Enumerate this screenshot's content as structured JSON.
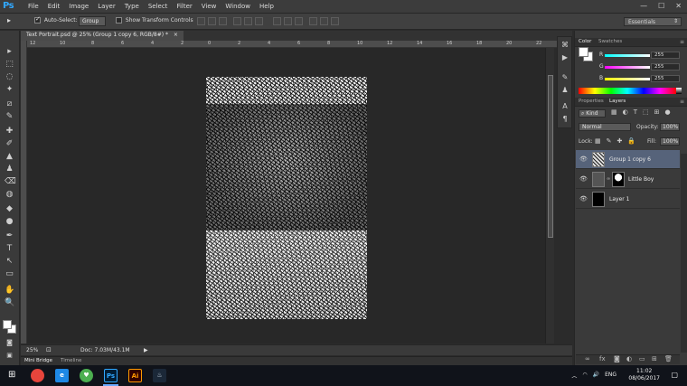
{
  "app": {
    "logo": "Ps",
    "menu": [
      "File",
      "Edit",
      "Image",
      "Layer",
      "Type",
      "Select",
      "Filter",
      "View",
      "Window",
      "Help"
    ],
    "window_controls": [
      "—",
      "☐",
      "✕"
    ]
  },
  "options_bar": {
    "tool_glyph": "▸",
    "auto_select_label": "Auto-Select:",
    "auto_select_checked": true,
    "auto_select_target": "Group",
    "transform_controls_label": "Show Transform Controls",
    "transform_controls_checked": false,
    "workspace": "Essentials"
  },
  "document": {
    "tab_title": "Text Portrait.psd @ 25% (Group 1 copy 6, RGB/8#) *",
    "ruler_top": [
      "12",
      "10",
      "8",
      "6",
      "4",
      "2",
      "0",
      "2",
      "4",
      "6",
      "8",
      "10",
      "12",
      "14",
      "16",
      "18",
      "20",
      "22"
    ],
    "zoom": "25%",
    "doc_info": "Doc: 7.03M/43.1M",
    "status_arrow": "▶"
  },
  "bottom_tabs": [
    "Mini Bridge",
    "Timeline"
  ],
  "tools": [
    "▸",
    "⬚",
    "◌",
    "✦",
    "⧄",
    "✎",
    "✚",
    "✐",
    "▲",
    "♟",
    "⌫",
    "◍",
    "◆",
    "●",
    "✒",
    "T",
    "↖",
    "▭",
    "✋",
    "🔍"
  ],
  "color_panel": {
    "tabs": [
      "Color",
      "Swatches"
    ],
    "channels": [
      {
        "label": "R",
        "value": "255",
        "color": "#ff2a2a"
      },
      {
        "label": "G",
        "value": "255",
        "color": "#2aff2a"
      },
      {
        "label": "B",
        "value": "255",
        "color": "#3a6cff"
      }
    ]
  },
  "layers_panel": {
    "tabs": [
      "Properties",
      "Layers"
    ],
    "filter": "Kind",
    "blend_mode": "Normal",
    "opacity_label": "Opacity:",
    "opacity_value": "100%",
    "lock_label": "Lock:",
    "fill_label": "Fill:",
    "fill_value": "100%",
    "layers": [
      {
        "name": "Group 1 copy 6",
        "selected": true
      },
      {
        "name": "Little Boy",
        "selected": false
      },
      {
        "name": "Layer 1",
        "selected": false
      }
    ]
  },
  "taskbar": {
    "apps": [
      {
        "label": "",
        "color": "#e8453c"
      },
      {
        "label": "e",
        "color": "#1e88e5"
      },
      {
        "label": "♥",
        "color": "#4caf50"
      },
      {
        "label": "Ps",
        "color": "#001e36"
      },
      {
        "label": "Ai",
        "color": "#330000"
      },
      {
        "label": "♨",
        "color": "#1b2838"
      }
    ],
    "language": "ENG",
    "time": "11:02",
    "date": "08/06/2017"
  }
}
